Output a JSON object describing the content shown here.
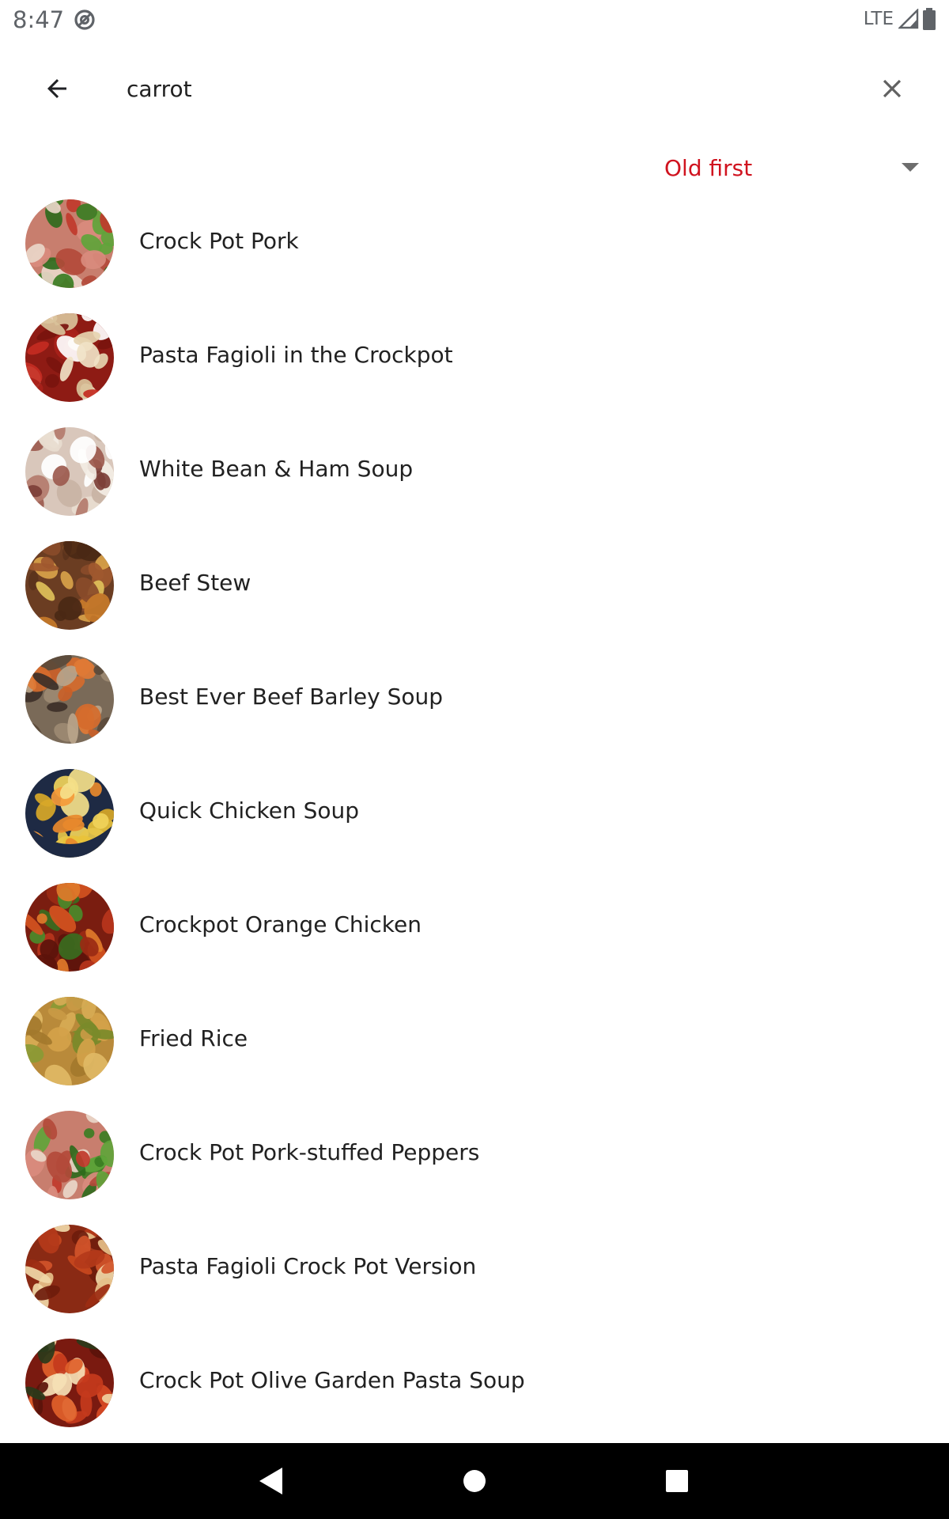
{
  "status_bar": {
    "time": "8:47",
    "network": "LTE",
    "icons": [
      "do-not-disturb-icon",
      "cell-signal-icon",
      "battery-icon"
    ]
  },
  "search": {
    "query": "carrot",
    "back_icon": "arrow-back-icon",
    "clear_icon": "close-icon"
  },
  "sort": {
    "selected": "Old first",
    "icon": "dropdown-arrow-icon"
  },
  "colors": {
    "accent": "#d0131f",
    "text": "#212121",
    "nav_bar": "#000000"
  },
  "recipes": [
    {
      "name": "Crock Pot Pork",
      "thumb": "stuffed-peppers"
    },
    {
      "name": "Pasta Fagioli in the Crockpot",
      "thumb": "bean-pasta"
    },
    {
      "name": "White Bean & Ham Soup",
      "thumb": "bean-ham-soup"
    },
    {
      "name": "Beef Stew",
      "thumb": "beef-stew"
    },
    {
      "name": "Best Ever Beef Barley Soup",
      "thumb": "barley-soup"
    },
    {
      "name": "Quick Chicken Soup",
      "thumb": "chicken-soup"
    },
    {
      "name": "Crockpot Orange Chicken",
      "thumb": "orange-chicken"
    },
    {
      "name": "Fried Rice",
      "thumb": "fried-rice"
    },
    {
      "name": "Crock Pot Pork-stuffed Peppers",
      "thumb": "stuffed-peppers"
    },
    {
      "name": "Pasta Fagioli Crock Pot Version",
      "thumb": "fagioli-soup"
    },
    {
      "name": "Crock Pot Olive Garden Pasta Soup",
      "thumb": "pasta-soup"
    }
  ],
  "nav": {
    "back": "nav-back-icon",
    "home": "nav-home-icon",
    "recents": "nav-recents-icon"
  }
}
